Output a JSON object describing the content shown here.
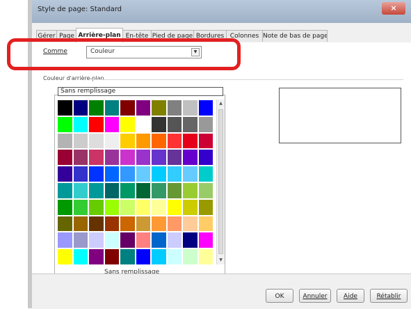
{
  "window": {
    "title": "Style de page: Standard",
    "close_label": "×"
  },
  "tabs": [
    {
      "label": "Gérer"
    },
    {
      "label": "Page"
    },
    {
      "label": "Arrière-plan"
    },
    {
      "label": "En-tête"
    },
    {
      "label": "Pied de page"
    },
    {
      "label": "Bordures"
    },
    {
      "label": "Colonnes"
    },
    {
      "label": "Note de bas de page"
    }
  ],
  "background": {
    "comme_label": "Comme",
    "type_value": "Couleur",
    "section_label": "Couleur d'arrière-plan",
    "no_fill_top": "Sans remplissage",
    "no_fill_bottom": "Sans remplissage"
  },
  "palette": [
    [
      "#000000",
      "#000080",
      "#008000",
      "#008080",
      "#800000",
      "#800080",
      "#808000",
      "#808080",
      "#c0c0c0",
      "#0000ff"
    ],
    [
      "#00ff00",
      "#00ffff",
      "#ff0000",
      "#ff00ff",
      "#ffff00",
      "#ffffff",
      "#333333",
      "#555555",
      "#666666",
      "#999999"
    ],
    [
      "#b3b3b3",
      "#cccccc",
      "#dddddd",
      "#eeeeee",
      "#ffcc00",
      "#ff9900",
      "#ff6600",
      "#ff3333",
      "#e6001a",
      "#cc0033"
    ],
    [
      "#990033",
      "#993366",
      "#cc3366",
      "#993399",
      "#cc33cc",
      "#9933cc",
      "#6633cc",
      "#663399",
      "#6600cc",
      "#3300cc"
    ],
    [
      "#330099",
      "#3333cc",
      "#0033ff",
      "#0066ff",
      "#3399ff",
      "#66ccff",
      "#00ccff",
      "#33ccff",
      "#66ccff",
      "#00cccc"
    ],
    [
      "#00999a",
      "#33cccc",
      "#009999",
      "#006666",
      "#009966",
      "#006633",
      "#339966",
      "#669933",
      "#99cc33",
      "#99cc66"
    ],
    [
      "#009900",
      "#33cc33",
      "#66cc00",
      "#99ff00",
      "#ccff66",
      "#ffff66",
      "#ffff99",
      "#ffff00",
      "#cccc00",
      "#999900"
    ],
    [
      "#666600",
      "#996600",
      "#663300",
      "#993300",
      "#cc6600",
      "#cc9933",
      "#ff9933",
      "#ff9966",
      "#ffcc99",
      "#ffcc66"
    ],
    [
      "#9999ff",
      "#9999cc",
      "#ccccff",
      "#ccffff",
      "#660066",
      "#ff8080",
      "#0066cc",
      "#ccccff",
      "#000080",
      "#ff00ff"
    ],
    [
      "#ffff00",
      "#00ffff",
      "#800080",
      "#800000",
      "#008080",
      "#0000ff",
      "#00ccff",
      "#ccffff",
      "#ccffcc",
      "#ffff99"
    ]
  ],
  "buttons": {
    "ok": "OK",
    "cancel": "Annuler",
    "help": "Aide",
    "reset": "Rétablir"
  }
}
